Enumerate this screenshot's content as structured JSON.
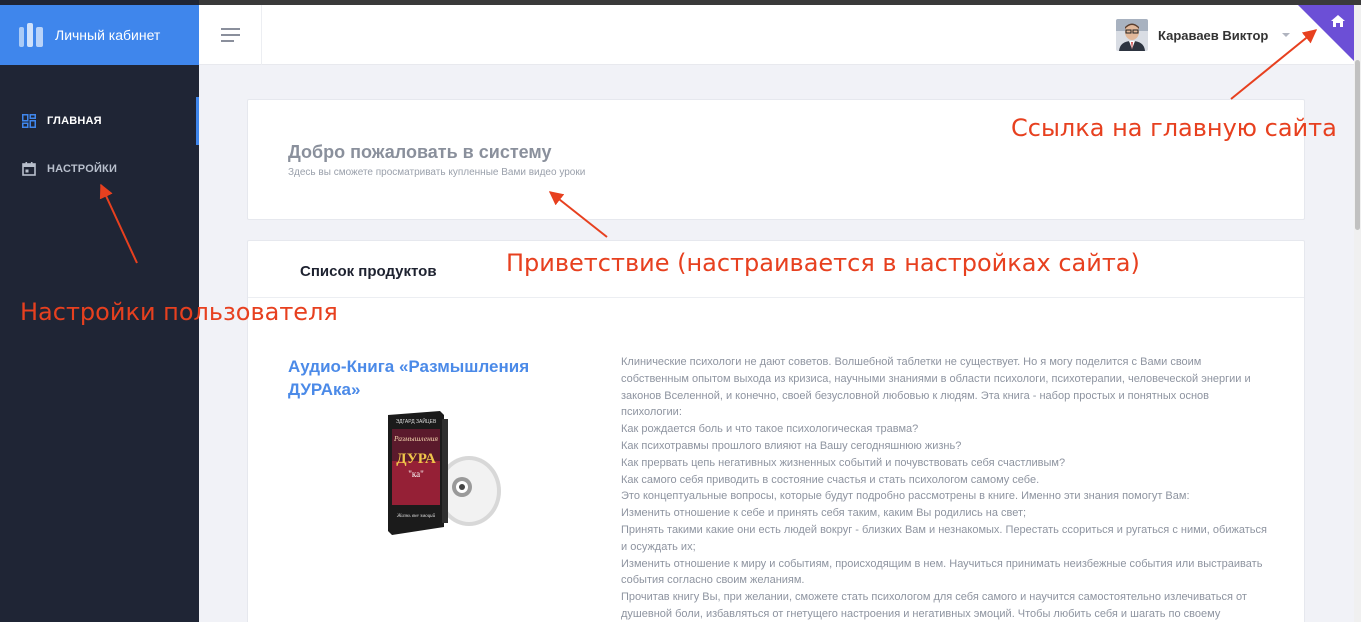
{
  "sidebar": {
    "brand": "Личный кабинет",
    "items": [
      {
        "label": "ГЛАВНАЯ",
        "icon": "dashboard-icon",
        "active": true
      },
      {
        "label": "НАСТРОЙКИ",
        "icon": "calendar-icon",
        "active": false
      }
    ]
  },
  "header": {
    "user_name": "Караваев Виктор",
    "home_icon": "home-icon"
  },
  "welcome": {
    "title": "Добро пожаловать в систему",
    "subtitle": "Здесь вы сможете просматривать купленные Вами видео уроки"
  },
  "products": {
    "title": "Список продуктов",
    "items": [
      {
        "name": "Аудио-Книга «Размышления ДУРАка»",
        "cover": {
          "author": "ЭДГАРД ЗАЙЦЕВ",
          "line1": "Размышления",
          "big": "ДУРА",
          "suffix": "\"ка\"",
          "tagline": "Жизнь вне эмоций"
        },
        "description": [
          "Клинические психологи не дают советов. Волшебной таблетки не существует. Но я могу поделится с Вами своим собственным опытом выхода из кризиса, научными знаниями в области психологи, психотерапии, человеческой энергии и законов Вселенной, и конечно, своей безусловной любовью к людям. Эта книга - набор простых и понятных основ психологии:",
          "Как рождается боль и что такое психологическая травма?",
          "Как психотравмы прошлого влияют на Вашу сегодняшнюю жизнь?",
          "Как прервать цепь негативных жизненных событий и почувствовать себя счастливым?",
          "Как самого себя приводить в состояние счастья и стать психологом самому себе.",
          "Это концептуальные вопросы, которые будут подробно рассмотрены в книге. Именно эти знания помогут Вам:",
          "Изменить отношение к себе и принять себя таким, каким Вы родились на свет;",
          "Принять такими какие они есть людей вокруг - близких Вам и незнакомых. Перестать ссориться и ругаться с ними, обижаться и осуждать их;",
          "Изменить отношение к миру и событиям, происходящим в нем. Научиться принимать неизбежные события или выстраивать события согласно своим желаниям.",
          "Прочитав книгу Вы, при желании, сможете стать психологом для себя самого и научится самостоятельно излечиваться от душевной боли, избавляться от гнетущего настроения и негативных эмоций. Чтобы любить себя и шагать по своему"
        ]
      }
    ]
  },
  "annotations": {
    "home_link": "Ссылка на главную сайта",
    "greeting": "Приветствие (настраивается в настройках сайта)",
    "user_settings": "Настройки пользователя"
  },
  "colors": {
    "sidebar_bg": "#1f2535",
    "brand_bg": "#3f86ec",
    "accent": "#4b8ae8",
    "annotation": "#e7401f",
    "home_corner": "#6c4fd6"
  }
}
